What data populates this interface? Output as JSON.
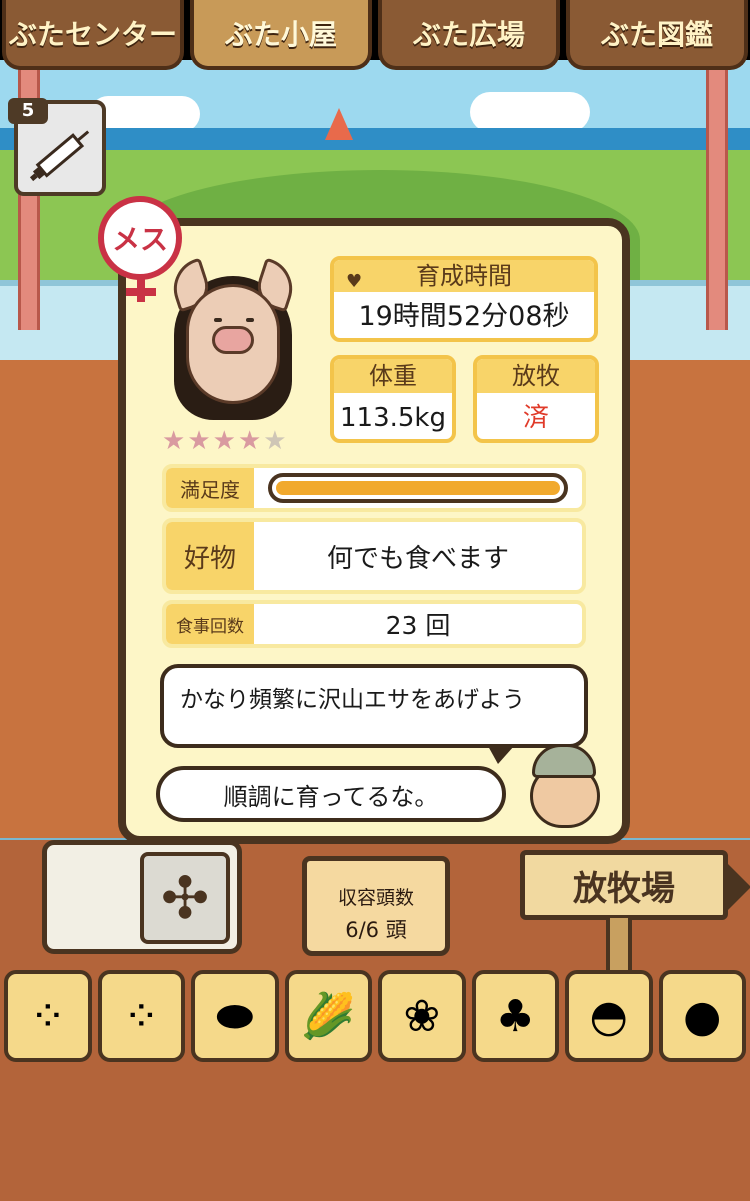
{
  "tabs": [
    {
      "label": "ぶたセンター",
      "active": false
    },
    {
      "label": "ぶた小屋",
      "active": true
    },
    {
      "label": "ぶた広場",
      "active": false
    },
    {
      "label": "ぶた図鑑",
      "active": false
    }
  ],
  "injection": {
    "count": "5",
    "icon": "syringe-icon"
  },
  "pig": {
    "gender_label": "メス",
    "rating": {
      "value": 4,
      "max": 5
    },
    "growth_time": {
      "label": "育成時間",
      "value": "19時間52分08秒"
    },
    "weight": {
      "label": "体重",
      "value": "113.5kg"
    },
    "grazing": {
      "label": "放牧",
      "value": "済"
    },
    "satisfaction": {
      "label": "満足度",
      "level": 1.0
    },
    "favorite": {
      "label": "好物",
      "value": "何でも食べます"
    },
    "meals": {
      "label": "食事回数",
      "value": "23 回"
    }
  },
  "advice": "かなり頻繁に沢山エサをあげよう",
  "comment": "順調に育ってるな。",
  "capacity": {
    "label": "収容頭数",
    "value": "6/6 頭"
  },
  "pasture_sign": "放牧場",
  "foods": [
    {
      "icon": "grain-pile-icon",
      "glyph": "⁘"
    },
    {
      "icon": "mixed-grain-icon",
      "glyph": "⁘"
    },
    {
      "icon": "sweet-potato-icon",
      "glyph": "⬬"
    },
    {
      "icon": "corn-icon",
      "glyph": "🌽"
    },
    {
      "icon": "vegetable-mix-icon",
      "glyph": "❀"
    },
    {
      "icon": "acorn-icon",
      "glyph": "♣"
    },
    {
      "icon": "feed-bowl-icon",
      "glyph": "◓"
    },
    {
      "icon": "meatball-plate-icon",
      "glyph": "●"
    }
  ],
  "colors": {
    "accent": "#f8d469",
    "frame": "#4a3420",
    "gender": "#c93245",
    "gauge": "#f1a92d"
  }
}
